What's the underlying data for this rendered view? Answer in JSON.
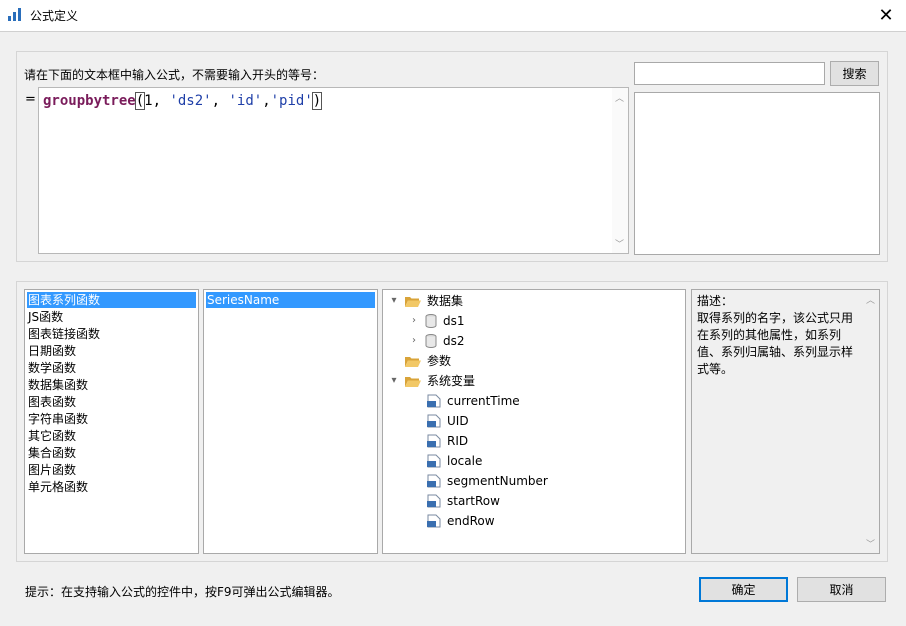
{
  "window": {
    "title": "公式定义",
    "close_glyph": "✕"
  },
  "editor": {
    "instruction": "请在下面的文本框中输入公式，不需要输入开头的等号：",
    "equals_sign": "=",
    "formula": {
      "function_name": "groupbytree",
      "open_paren": "(",
      "arg1": "1, ",
      "arg2": "'ds2'",
      "comma1": ", ",
      "arg3": "'id'",
      "comma2": ",",
      "arg4": "'pid'",
      "close_paren": ")"
    }
  },
  "search": {
    "input_value": "",
    "button_label": "搜索"
  },
  "categories": {
    "items": [
      "图表系列函数",
      "JS函数",
      "图表链接函数",
      "日期函数",
      "数学函数",
      "数据集函数",
      "图表函数",
      "字符串函数",
      "其它函数",
      "集合函数",
      "图片函数",
      "单元格函数"
    ],
    "selected_index": 0
  },
  "functions": {
    "items": [
      "SeriesName"
    ],
    "selected_index": 0
  },
  "tree": {
    "datasets_label": "数据集",
    "ds1": "ds1",
    "ds2": "ds2",
    "params_label": "参数",
    "sysvars_label": "系统变量",
    "sysvars": [
      "currentTime",
      "UID",
      "RID",
      "locale",
      "segmentNumber",
      "startRow",
      "endRow"
    ]
  },
  "description": {
    "label": "描述：",
    "text": "取得系列的名字，该公式只用在系列的其他属性，如系列值、系列归属轴、系列显示样式等。"
  },
  "footer": {
    "hint": "提示：在支持输入公式的控件中，按F9可弹出公式编辑器。",
    "ok_label": "确定",
    "cancel_label": "取消"
  },
  "colors": {
    "selection": "#3399ff",
    "function_name": "#7a1c5b",
    "string_literal": "#1f3fa8",
    "primary_border": "#0078d7",
    "folder": "#e8b84a"
  }
}
